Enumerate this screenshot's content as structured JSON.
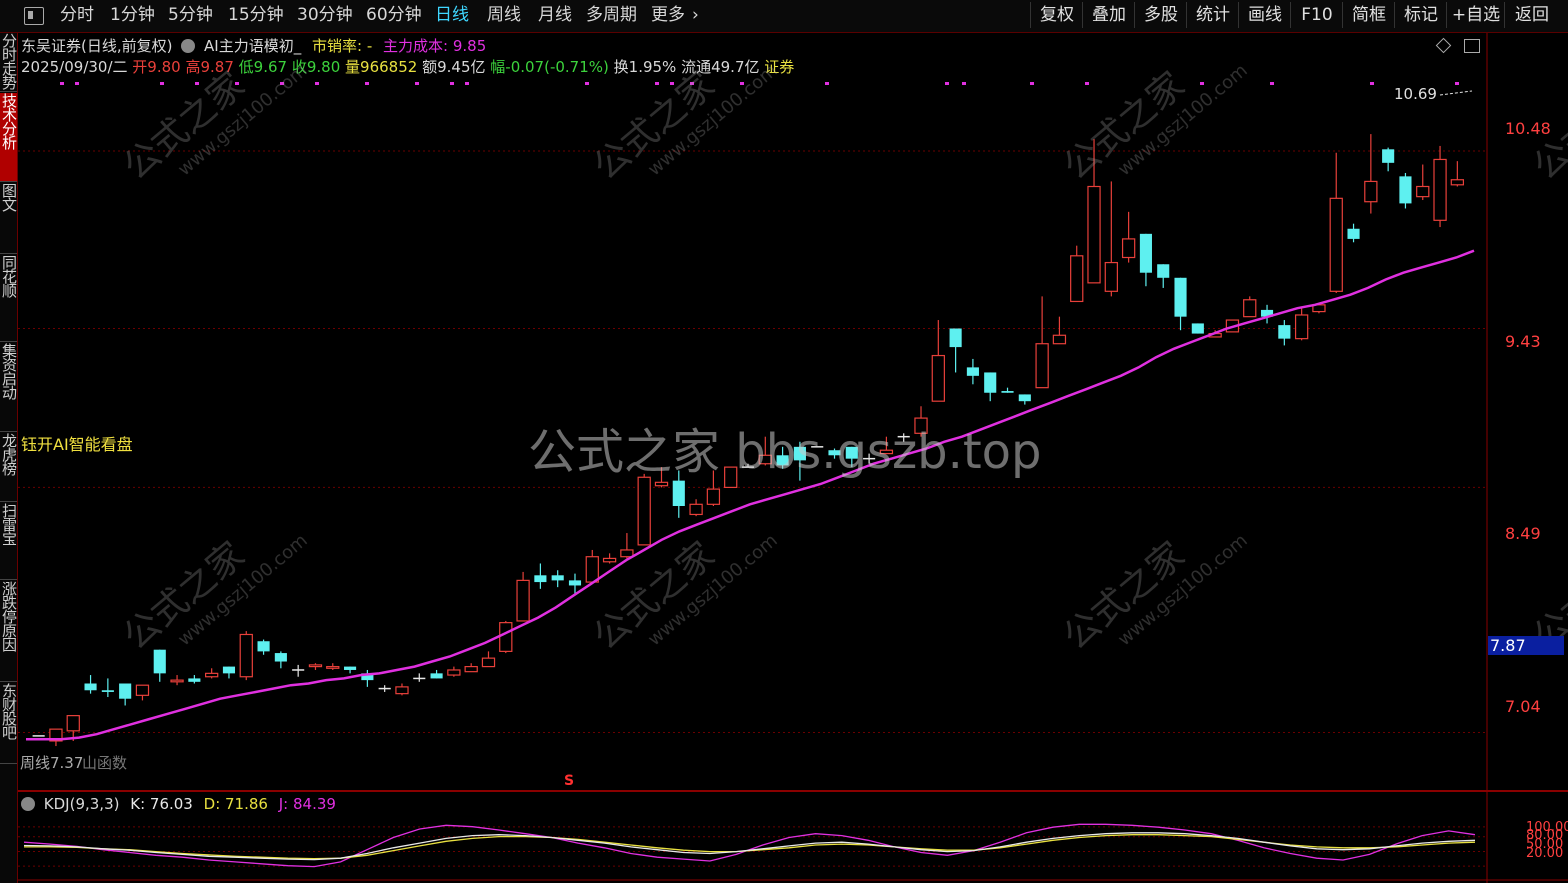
{
  "toolbar": {
    "left_items": [
      "分时",
      "1分钟",
      "5分钟",
      "15分钟",
      "30分钟",
      "60分钟",
      "日线",
      "周线",
      "月线",
      "多周期",
      "更多"
    ],
    "active_item": "日线",
    "right_items": [
      "复权",
      "叠加",
      "多股",
      "统计",
      "画线",
      "F10",
      "简框",
      "标记",
      "+自选",
      "返回"
    ]
  },
  "sidebar": {
    "items": [
      "分时走势",
      "技术分析",
      "图文F10",
      "同花顺F10",
      "集资启动",
      "龙虎榜",
      "扫雷宝",
      "涨跌停原因",
      "东财股吧"
    ],
    "active_item": "技术分析"
  },
  "header": {
    "stock_title": "东吴证券(日线,前复权)",
    "indicator_name": "AI主力语模初_",
    "ps_label": "市销率: -",
    "main_cost": "主力成本: 9.85",
    "date": "2025/09/30/二",
    "open": "开9.80",
    "high": "高9.87",
    "low": "低9.67",
    "close": "收9.80",
    "volume": "量966852",
    "amount": "额9.45亿",
    "change": "幅-0.07(-0.71%)",
    "turnover": "换1.95%",
    "float": "流通49.7亿",
    "sector": "证券"
  },
  "overlay_labels": {
    "ai_button": "钰开AI智能看盘",
    "bottom_left": "周线7.37",
    "bottom_left2": "山函数",
    "max_marker": "10.69",
    "s_marker": "S"
  },
  "watermark": {
    "center": "公式之家 bbs.gszb.top",
    "tile": "公式之家",
    "tile_url": "www.gszj100.com"
  },
  "price_axis": {
    "labels": [
      "10.48",
      "9.43",
      "8.49",
      "7.87",
      "7.04"
    ],
    "highlight": "7.87"
  },
  "kdj": {
    "name": "KDJ(9,3,3)",
    "k": "K: 76.03",
    "d": "D: 71.86",
    "j": "J: 84.39",
    "axis_labels": [
      "100.00",
      "80.00",
      "50.00",
      "20.00"
    ]
  },
  "colors": {
    "up": "#e8403a",
    "down": "#5ef0f0",
    "ma": "#e030e0",
    "k": "#e8e8e8",
    "d": "#e8e040",
    "j": "#e030e0",
    "background": "#000000",
    "accent": "#3fd7ff"
  },
  "chart_data": {
    "type": "candlestick",
    "y_range": [
      6.7,
      10.9
    ],
    "ma_line": [
      7.0,
      7.0,
      7.0,
      7.01,
      7.03,
      7.06,
      7.09,
      7.12,
      7.15,
      7.18,
      7.21,
      7.24,
      7.26,
      7.28,
      7.3,
      7.32,
      7.33,
      7.35,
      7.36,
      7.38,
      7.39,
      7.41,
      7.43,
      7.46,
      7.49,
      7.53,
      7.57,
      7.62,
      7.67,
      7.72,
      7.78,
      7.85,
      7.92,
      7.99,
      8.06,
      8.12,
      8.18,
      8.23,
      8.27,
      8.31,
      8.35,
      8.39,
      8.42,
      8.45,
      8.48,
      8.51,
      8.55,
      8.59,
      8.63,
      8.66,
      8.69,
      8.72,
      8.76,
      8.79,
      8.83,
      8.87,
      8.91,
      8.95,
      8.99,
      9.03,
      9.07,
      9.11,
      9.15,
      9.2,
      9.26,
      9.31,
      9.35,
      9.39,
      9.43,
      9.46,
      9.49,
      9.52,
      9.55,
      9.57,
      9.6,
      9.63,
      9.67,
      9.72,
      9.76,
      9.79,
      9.82,
      9.85,
      9.89
    ],
    "candles": [
      [
        7.02,
        7.02,
        7.02,
        7.02
      ],
      [
        6.99,
        7.06,
        6.96,
        7.05
      ],
      [
        7.05,
        7.14,
        6.99,
        7.12
      ],
      [
        7.33,
        7.29,
        7.38,
        7.27
      ],
      [
        7.29,
        7.28,
        7.36,
        7.25
      ],
      [
        7.33,
        7.24,
        7.33,
        7.2
      ],
      [
        7.26,
        7.32,
        7.23,
        7.32
      ],
      [
        7.53,
        7.39,
        7.53,
        7.34
      ],
      [
        7.34,
        7.35,
        7.38,
        7.32
      ],
      [
        7.36,
        7.34,
        7.38,
        7.33
      ],
      [
        7.37,
        7.39,
        7.36,
        7.42
      ],
      [
        7.43,
        7.39,
        7.43,
        7.36
      ],
      [
        7.37,
        7.62,
        7.35,
        7.64
      ],
      [
        7.58,
        7.52,
        7.59,
        7.5
      ],
      [
        7.51,
        7.46,
        7.52,
        7.42
      ],
      [
        7.41,
        7.41,
        7.44,
        7.37
      ],
      [
        7.43,
        7.44,
        7.45,
        7.41
      ],
      [
        7.42,
        7.43,
        7.45,
        7.41
      ],
      [
        7.43,
        7.41,
        7.43,
        7.39
      ],
      [
        7.39,
        7.35,
        7.41,
        7.31
      ],
      [
        7.3,
        7.3,
        7.32,
        7.28
      ],
      [
        7.27,
        7.31,
        7.26,
        7.33
      ],
      [
        7.36,
        7.36,
        7.39,
        7.34
      ],
      [
        7.39,
        7.36,
        7.38,
        7.41
      ],
      [
        7.38,
        7.41,
        7.37,
        7.43
      ],
      [
        7.4,
        7.43,
        7.4,
        7.45
      ],
      [
        7.43,
        7.48,
        7.43,
        7.52
      ],
      [
        7.52,
        7.69,
        7.51,
        7.7
      ],
      [
        7.7,
        7.94,
        7.7,
        7.99
      ],
      [
        7.97,
        7.93,
        8.04,
        7.89
      ],
      [
        7.97,
        7.94,
        8.0,
        7.9
      ],
      [
        7.94,
        7.91,
        7.98,
        7.86
      ],
      [
        7.93,
        8.08,
        7.93,
        8.12
      ],
      [
        8.05,
        8.07,
        8.04,
        8.1
      ],
      [
        8.08,
        8.12,
        8.07,
        8.22
      ],
      [
        8.15,
        8.55,
        8.15,
        8.57
      ],
      [
        8.5,
        8.52,
        8.49,
        8.61
      ],
      [
        8.53,
        8.38,
        8.59,
        8.31
      ],
      [
        8.33,
        8.39,
        8.32,
        8.42
      ],
      [
        8.39,
        8.48,
        8.38,
        8.59
      ],
      [
        8.49,
        8.61,
        8.49,
        8.61
      ],
      [
        8.61,
        8.61,
        8.61,
        8.63
      ],
      [
        8.63,
        8.68,
        8.62,
        8.79
      ],
      [
        8.68,
        8.62,
        8.73,
        8.6
      ],
      [
        8.73,
        8.65,
        8.76,
        8.53
      ],
      [
        8.73,
        8.73,
        8.73,
        8.73
      ],
      [
        8.71,
        8.68,
        8.72,
        8.66
      ],
      [
        8.73,
        8.66,
        8.73,
        8.61
      ],
      [
        8.66,
        8.66,
        8.69,
        8.63
      ],
      [
        8.69,
        8.71,
        8.7,
        8.79
      ],
      [
        8.79,
        8.79,
        8.76,
        8.81
      ],
      [
        8.81,
        8.9,
        8.79,
        8.97
      ],
      [
        9.0,
        9.27,
        9.0,
        9.48
      ],
      [
        9.43,
        9.32,
        9.43,
        9.17
      ],
      [
        9.2,
        9.15,
        9.25,
        9.1
      ],
      [
        9.17,
        9.05,
        9.17,
        9.0
      ],
      [
        9.06,
        9.05,
        9.06,
        9.08
      ],
      [
        9.04,
        9.0,
        9.03,
        8.98
      ],
      [
        9.08,
        9.34,
        9.08,
        9.62
      ],
      [
        9.34,
        9.39,
        9.34,
        9.5
      ],
      [
        9.59,
        9.86,
        9.59,
        9.92
      ],
      [
        9.7,
        10.27,
        9.7,
        10.55
      ],
      [
        9.65,
        9.82,
        9.62,
        10.3
      ],
      [
        9.85,
        9.96,
        9.82,
        10.12
      ],
      [
        9.99,
        9.76,
        9.99,
        9.68
      ],
      [
        9.81,
        9.73,
        9.81,
        9.67
      ],
      [
        9.73,
        9.5,
        9.73,
        9.42
      ],
      [
        9.46,
        9.4,
        9.46,
        9.4
      ],
      [
        9.38,
        9.4,
        9.38,
        9.42
      ],
      [
        9.41,
        9.48,
        9.41,
        9.48
      ],
      [
        9.5,
        9.6,
        9.5,
        9.62
      ],
      [
        9.54,
        9.5,
        9.57,
        9.46
      ],
      [
        9.45,
        9.37,
        9.48,
        9.33
      ],
      [
        9.37,
        9.51,
        9.36,
        9.55
      ],
      [
        9.53,
        9.57,
        9.52,
        9.57
      ],
      [
        9.65,
        10.2,
        9.64,
        10.47
      ],
      [
        10.02,
        9.96,
        10.05,
        9.94
      ],
      [
        10.18,
        10.3,
        10.11,
        10.58
      ],
      [
        10.49,
        10.41,
        10.5,
        10.36
      ],
      [
        10.33,
        10.17,
        10.35,
        10.14
      ],
      [
        10.21,
        10.27,
        10.19,
        10.4
      ],
      [
        10.07,
        10.43,
        10.03,
        10.51
      ],
      [
        10.28,
        10.31,
        10.27,
        10.42
      ]
    ],
    "kdj": {
      "k": [
        65,
        64,
        62,
        58,
        55,
        50,
        46,
        42,
        40,
        38,
        36,
        35,
        38,
        48,
        60,
        70,
        80,
        86,
        88,
        86,
        82,
        76,
        70,
        62,
        56,
        50,
        48,
        52,
        58,
        64,
        70,
        72,
        68,
        62,
        56,
        52,
        54,
        62,
        72,
        80,
        86,
        90,
        92,
        92,
        90,
        86,
        80,
        72,
        64,
        58,
        56,
        58,
        64,
        70,
        74,
        76
      ],
      "d": [
        62,
        62,
        61,
        58,
        56,
        52,
        48,
        45,
        42,
        40,
        38,
        37,
        38,
        44,
        54,
        64,
        74,
        80,
        84,
        84,
        82,
        78,
        72,
        66,
        60,
        55,
        52,
        52,
        56,
        60,
        66,
        68,
        66,
        62,
        58,
        55,
        55,
        60,
        68,
        76,
        82,
        86,
        88,
        88,
        86,
        84,
        78,
        72,
        66,
        62,
        60,
        60,
        62,
        66,
        70,
        72
      ],
      "j": [
        72,
        68,
        63,
        56,
        50,
        44,
        40,
        34,
        30,
        26,
        22,
        20,
        30,
        56,
        82,
        100,
        108,
        105,
        98,
        90,
        82,
        70,
        60,
        48,
        40,
        36,
        32,
        46,
        66,
        82,
        90,
        86,
        76,
        62,
        50,
        44,
        54,
        72,
        92,
        104,
        110,
        110,
        108,
        104,
        98,
        90,
        76,
        60,
        48,
        38,
        34,
        46,
        68,
        86,
        96,
        88
      ]
    }
  }
}
